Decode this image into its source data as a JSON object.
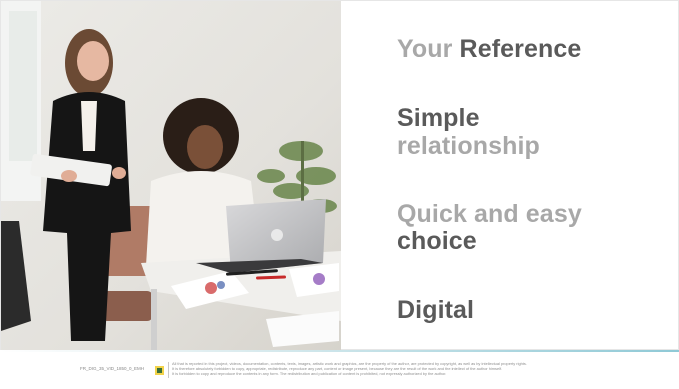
{
  "headline": {
    "line1_a": "Your",
    "line1_b": "Reference",
    "line2": "Simple",
    "line3": "relationship",
    "line4": "Quick and easy",
    "line5": "choice",
    "line6": "Digital"
  },
  "footer": {
    "code": "FR_DIG_35_VID_1850_0_EMH",
    "legal_line1": "All that is reported in this project, videos, documentation, contents, texts, images, artistic work and graphics, are the property of the author, are protected by copyright, as well as by intellectual property rights.",
    "legal_line2": "It is therefore absolutely forbidden to copy, appropriate, redistribute, reproduce any part, content or image present, because they are the result of the work and the intellect of the author himself.",
    "legal_line3": "It is forbidden to copy and reproduce the contents in any form.    The redistribution and publication of content is prohibited, not expressly authorized by the author."
  },
  "colors": {
    "text_dim": "#a8a8a8",
    "text_dark": "#5a5a5a",
    "footer_accent": "#8fc9d6"
  }
}
